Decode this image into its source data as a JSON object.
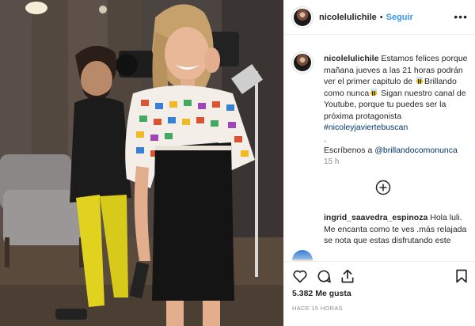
{
  "post": {
    "username": "nicolelulichile",
    "separator": "•",
    "follow_label": "Seguir",
    "more_label": "•••"
  },
  "caption": {
    "username": "nicolelulichile",
    "text_1": " Estamos felices porque mañana jueves a las 21 horas podrán ver el primer capitulo de ",
    "text_2": "Brillando como nunca",
    "text_3": " Sigan nuestro canal de Youtube, porque tu puedes ser la próxima protagonista ",
    "hashtag": "#nicoleyjaviertebuscan",
    "dot_line": ".",
    "text_4": "Escríbenos a ",
    "mention": "@brillandocomonunca",
    "time": "15 h"
  },
  "comment": {
    "username": "ingrid_saavedra_espinoza",
    "text": " Hola luli. Me encanta como te ves .más relajada se nota que estas disfrutando este"
  },
  "footer": {
    "likes": "5.382 Me gusta",
    "posted": "HACE 15 HORAS"
  },
  "icons": {
    "like": "heart-icon",
    "comment": "comment-icon",
    "share": "share-icon",
    "save": "bookmark-icon",
    "load": "plus-circle-icon",
    "bee": "bee-emoji"
  }
}
